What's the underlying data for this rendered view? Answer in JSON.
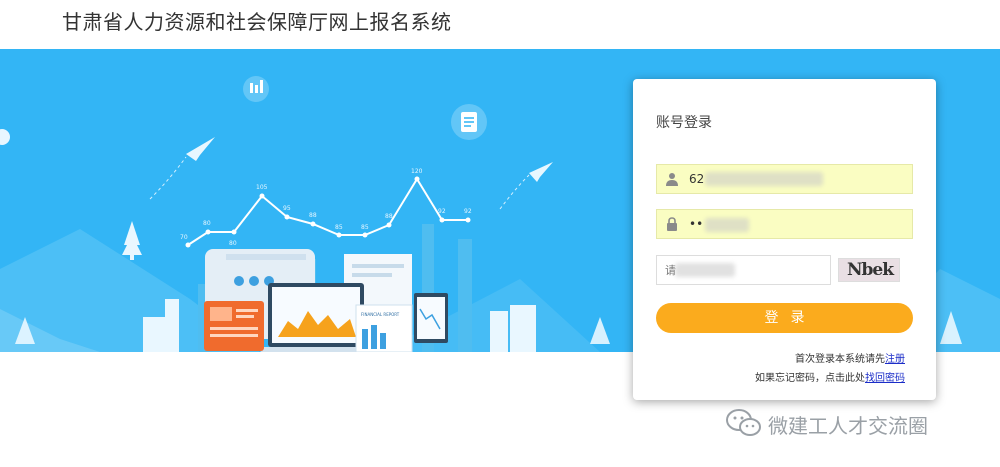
{
  "header": {
    "title": "甘肃省人力资源和社会保障厅网上报名系统"
  },
  "banner": {
    "chart_values": [
      "70",
      "80",
      "80",
      "105",
      "95",
      "88",
      "85",
      "85",
      "88",
      "120",
      "92",
      "92"
    ],
    "report_label": "FINANCIAL REPORT"
  },
  "login": {
    "title": "账号登录",
    "username_value": "62",
    "password_value": "••",
    "captcha_placeholder": "请",
    "captcha_text": "Nbek",
    "submit_label": "登录",
    "register_hint": "首次登录本系统请先",
    "register_link": "注册",
    "forgot_hint": "如果忘记密码，点击此处",
    "forgot_link": "找回密码"
  },
  "watermark": {
    "text": "微建工人才交流圈"
  },
  "colors": {
    "banner": "#33b5f5",
    "button": "#fbab1d",
    "field_fill": "#fafdc2",
    "link": "#1b2dc8"
  }
}
